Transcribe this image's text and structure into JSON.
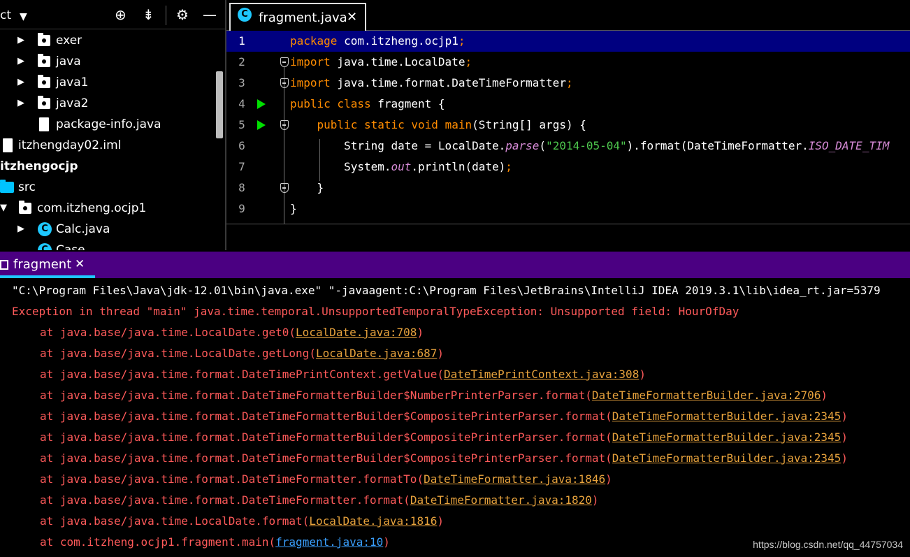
{
  "project": {
    "title": "ct",
    "tree": [
      {
        "label": "exer",
        "type": "folder",
        "expanded": false
      },
      {
        "label": "java",
        "type": "folder",
        "expanded": false
      },
      {
        "label": "java1",
        "type": "folder",
        "expanded": false
      },
      {
        "label": "java2",
        "type": "folder",
        "expanded": false
      },
      {
        "label": "package-info.java",
        "type": "file"
      },
      {
        "label": "itzhengday02.iml",
        "type": "file"
      },
      {
        "label": "itzhengocjp",
        "type": "module"
      },
      {
        "label": "src",
        "type": "source-folder"
      },
      {
        "label": "com.itzheng.ocjp1",
        "type": "package",
        "expanded": true
      },
      {
        "label": "Calc.java",
        "type": "class"
      },
      {
        "label": "Case",
        "type": "class"
      }
    ]
  },
  "editor": {
    "tab_label": "fragment.java",
    "tab_close": "✕",
    "lines": [
      {
        "n": "1",
        "parts": [
          {
            "t": "package",
            "c": "kw"
          },
          {
            "t": " com.itzheng.ocjp1",
            "c": ""
          },
          {
            "t": ";",
            "c": "kw"
          }
        ]
      },
      {
        "n": "2",
        "parts": [
          {
            "t": "import",
            "c": "kw"
          },
          {
            "t": " java.time.LocalDate",
            "c": ""
          },
          {
            "t": ";",
            "c": "kw"
          }
        ]
      },
      {
        "n": "3",
        "parts": [
          {
            "t": "import",
            "c": "kw"
          },
          {
            "t": " java.time.format.DateTimeFormatter",
            "c": ""
          },
          {
            "t": ";",
            "c": "kw"
          }
        ]
      },
      {
        "n": "4",
        "parts": [
          {
            "t": "public class",
            "c": "kw"
          },
          {
            "t": " fragment {",
            "c": ""
          }
        ]
      },
      {
        "n": "5",
        "parts": [
          {
            "t": "    public static void",
            "c": "kw"
          },
          {
            "t": " ",
            "c": ""
          },
          {
            "t": "main",
            "c": "kw"
          },
          {
            "t": "(String[] args) {",
            "c": ""
          }
        ]
      },
      {
        "n": "6",
        "parts": [
          {
            "t": "        String date = LocalDate.",
            "c": ""
          },
          {
            "t": "parse",
            "c": "ital"
          },
          {
            "t": "(",
            "c": ""
          },
          {
            "t": "\"2014-05-04\"",
            "c": "str"
          },
          {
            "t": ").format(DateTimeFormatter.",
            "c": ""
          },
          {
            "t": "ISO_DATE_TIM",
            "c": "ital"
          }
        ]
      },
      {
        "n": "7",
        "parts": [
          {
            "t": "        System.",
            "c": ""
          },
          {
            "t": "out",
            "c": "ital"
          },
          {
            "t": ".println(date)",
            "c": ""
          },
          {
            "t": ";",
            "c": "kw"
          }
        ]
      },
      {
        "n": "8",
        "parts": [
          {
            "t": "    }",
            "c": ""
          }
        ]
      },
      {
        "n": "9",
        "parts": [
          {
            "t": "}",
            "c": ""
          }
        ]
      }
    ]
  },
  "run": {
    "tab_label": "fragment",
    "tab_close": "✕",
    "command": "\"C:\\Program Files\\Java\\jdk-12.01\\bin\\java.exe\" \"-javaagent:C:\\Program Files\\JetBrains\\IntelliJ IDEA 2019.3.1\\lib\\idea_rt.jar=5379",
    "exception": "Exception in thread \"main\" java.time.temporal.UnsupportedTemporalTypeException: Unsupported field: HourOfDay",
    "stack": [
      {
        "method": "at java.base/java.time.LocalDate.get0(",
        "link": "LocalDate.java:708",
        "user": false
      },
      {
        "method": "at java.base/java.time.LocalDate.getLong(",
        "link": "LocalDate.java:687",
        "user": false
      },
      {
        "method": "at java.base/java.time.format.DateTimePrintContext.getValue(",
        "link": "DateTimePrintContext.java:308",
        "user": false
      },
      {
        "method": "at java.base/java.time.format.DateTimeFormatterBuilder$NumberPrinterParser.format(",
        "link": "DateTimeFormatterBuilder.java:2706",
        "user": false
      },
      {
        "method": "at java.base/java.time.format.DateTimeFormatterBuilder$CompositePrinterParser.format(",
        "link": "DateTimeFormatterBuilder.java:2345",
        "user": false
      },
      {
        "method": "at java.base/java.time.format.DateTimeFormatterBuilder$CompositePrinterParser.format(",
        "link": "DateTimeFormatterBuilder.java:2345",
        "user": false
      },
      {
        "method": "at java.base/java.time.format.DateTimeFormatterBuilder$CompositePrinterParser.format(",
        "link": "DateTimeFormatterBuilder.java:2345",
        "user": false
      },
      {
        "method": "at java.base/java.time.format.DateTimeFormatter.formatTo(",
        "link": "DateTimeFormatter.java:1846",
        "user": false
      },
      {
        "method": "at java.base/java.time.format.DateTimeFormatter.format(",
        "link": "DateTimeFormatter.java:1820",
        "user": false
      },
      {
        "method": "at java.base/java.time.LocalDate.format(",
        "link": "LocalDate.java:1816",
        "user": false
      },
      {
        "method": "at com.itzheng.ocjp1.fragment.main(",
        "link": "fragment.java:10",
        "user": true
      }
    ]
  },
  "watermark": "https://blog.csdn.net/qq_44757034"
}
